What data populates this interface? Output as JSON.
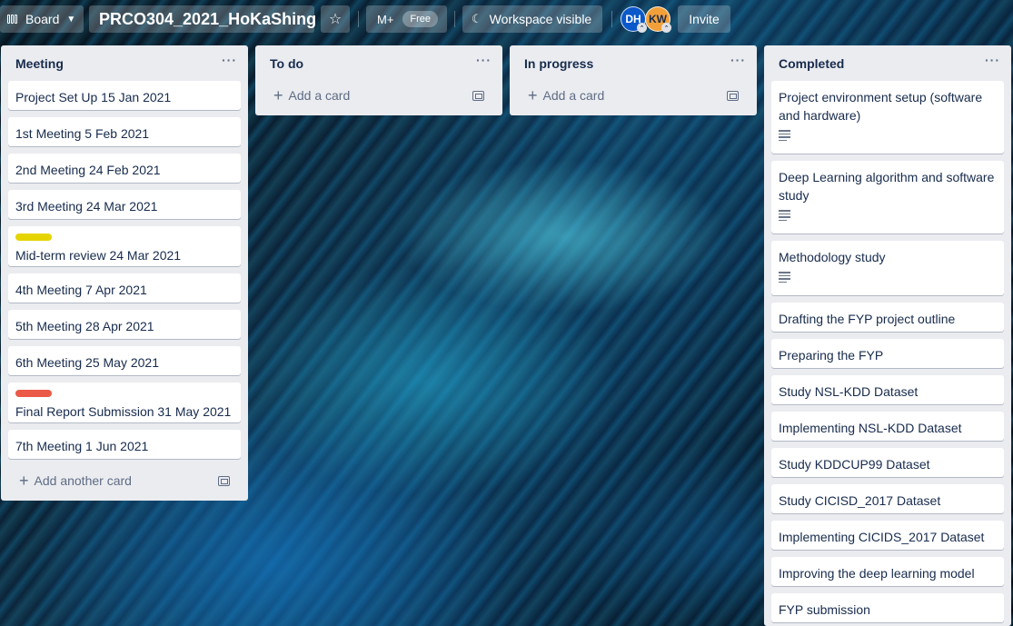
{
  "header": {
    "board_button": "Board",
    "board_title": "PRCO304_2021_HoKaShing",
    "mplus": "M+",
    "free_badge": "Free",
    "visibility": "Workspace visible",
    "avatars": [
      "DH",
      "KW"
    ],
    "invite": "Invite"
  },
  "lists": [
    {
      "title": "Meeting",
      "menu": "···",
      "add_label": "Add another card",
      "cards": [
        {
          "text": "Project Set Up 15 Jan 2021"
        },
        {
          "text": "1st Meeting 5 Feb 2021"
        },
        {
          "text": "2nd Meeting 24 Feb 2021"
        },
        {
          "text": "3rd Meeting 24 Mar 2021"
        },
        {
          "text": "Mid-term review 24 Mar 2021",
          "label_color": "#e6d400"
        },
        {
          "text": "4th Meeting 7 Apr 2021"
        },
        {
          "text": "5th Meeting 28 Apr 2021"
        },
        {
          "text": "6th Meeting 25 May 2021"
        },
        {
          "text": "Final Report Submission 31 May 2021",
          "label_color": "#eb5a46"
        },
        {
          "text": "7th Meeting 1 Jun 2021"
        }
      ]
    },
    {
      "title": "To do",
      "menu": "···",
      "add_label": "Add a card",
      "cards": []
    },
    {
      "title": "In progress",
      "menu": "···",
      "add_label": "Add a card",
      "cards": []
    },
    {
      "title": "Completed",
      "menu": "···",
      "cards": [
        {
          "text": "Project environment setup (software and hardware)",
          "has_description": true
        },
        {
          "text": "Deep Learning algorithm and software study",
          "has_description": true
        },
        {
          "text": "Methodology study",
          "has_description": true
        },
        {
          "text": "Drafting the FYP project outline"
        },
        {
          "text": "Preparing the FYP"
        },
        {
          "text": "Study NSL-KDD Dataset"
        },
        {
          "text": "Implementing NSL-KDD Dataset"
        },
        {
          "text": "Study KDDCUP99 Dataset"
        },
        {
          "text": "Study CICISD_2017 Dataset"
        },
        {
          "text": "Implementing CICIDS_2017 Dataset"
        },
        {
          "text": "Improving the deep learning model"
        },
        {
          "text": "FYP submission"
        }
      ]
    }
  ]
}
